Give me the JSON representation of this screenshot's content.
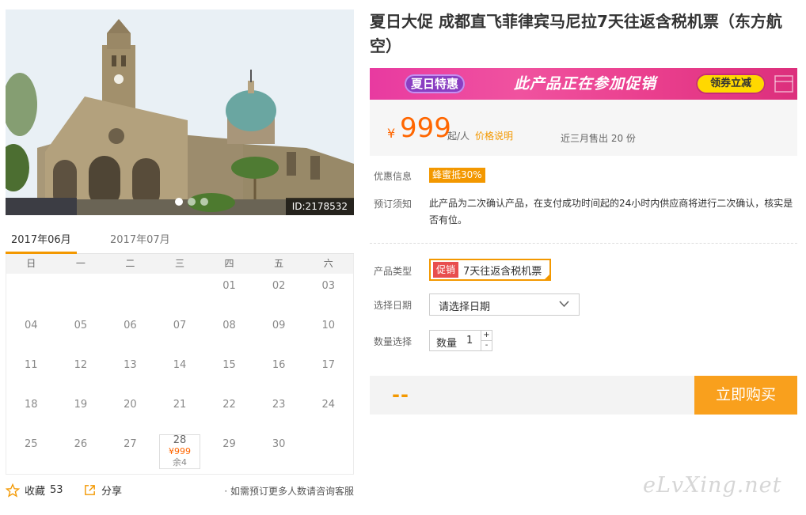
{
  "gallery": {
    "image_id": "ID:2178532",
    "slide_count": 3,
    "active_slide": 1
  },
  "calendar": {
    "months": [
      "2017年06月",
      "2017年07月"
    ],
    "active_month": 0,
    "weekdays": [
      "日",
      "一",
      "二",
      "三",
      "四",
      "五",
      "六"
    ],
    "leading_blanks": 4,
    "days": [
      "01",
      "02",
      "03",
      "04",
      "05",
      "06",
      "07",
      "08",
      "09",
      "10",
      "11",
      "12",
      "13",
      "14",
      "15",
      "16",
      "17",
      "18",
      "19",
      "20",
      "21",
      "22",
      "23",
      "24",
      "25",
      "26",
      "27",
      "28",
      "29",
      "30"
    ],
    "available": [
      {
        "day": "28",
        "price": "¥999",
        "stock": "余4"
      }
    ]
  },
  "actions": {
    "favorite_label": "收藏",
    "favorite_count": "53",
    "share_label": "分享",
    "consult_note": "· 如需预订更多人数请咨询客服"
  },
  "product": {
    "title": "夏日大促 成都直飞菲律宾马尼拉7天往返含税机票（东方航空）",
    "banner": {
      "badge": "夏日特惠",
      "text": "此产品正在参加促销",
      "button": "领券立减"
    },
    "price": {
      "currency": "¥",
      "value": "999",
      "unit": "起/人",
      "explain_link": "价格说明",
      "sold": "近三月售出 20 份"
    },
    "discount": {
      "label": "优惠信息",
      "badge": "蜂蜜抵30%"
    },
    "notice": {
      "label": "预订须知",
      "text": "此产品为二次确认产品，在支付成功时间起的24小时内供应商将进行二次确认，核实是否有位。"
    },
    "type": {
      "label": "产品类型",
      "tag": "促销",
      "value": "7天往返含税机票"
    },
    "date": {
      "label": "选择日期",
      "placeholder": "请选择日期"
    },
    "quantity": {
      "label": "数量选择",
      "prefix": "数量",
      "value": "1",
      "plus": "+",
      "minus": "-"
    },
    "total": "--",
    "buy_button": "立即购买"
  },
  "watermark": "eLvXing.net",
  "colors": {
    "accent": "#f39800",
    "price": "#ff6600",
    "banner": "#e83aa0"
  }
}
